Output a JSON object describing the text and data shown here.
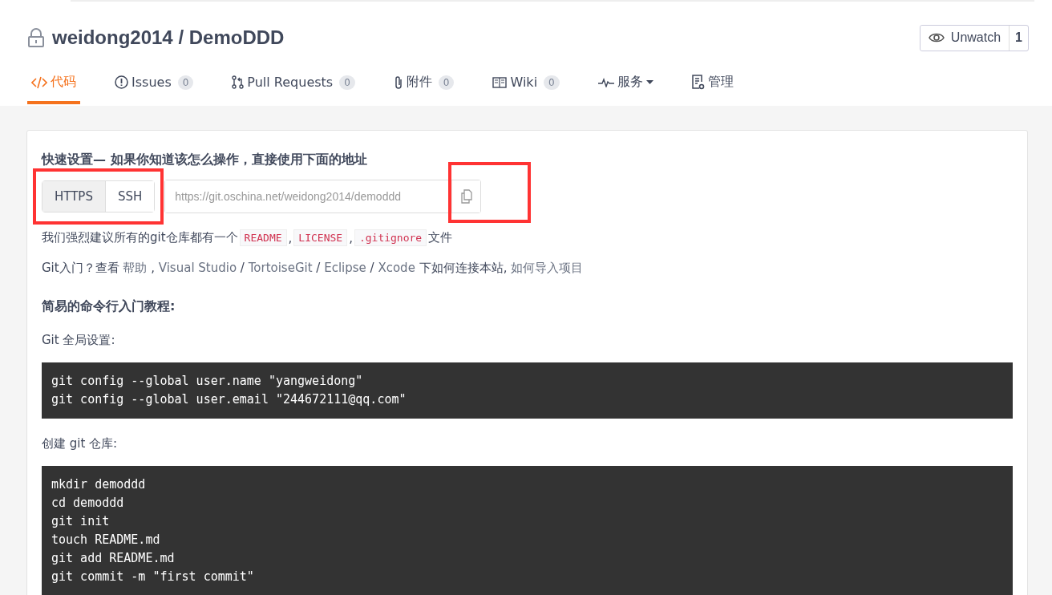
{
  "repo": {
    "owner": "weidong2014",
    "separator": "/",
    "name": "DemoDDD",
    "private": true
  },
  "watch": {
    "label": "Unwatch",
    "count": "1"
  },
  "tabs": [
    {
      "label": "代码",
      "dropdown": false,
      "selected": true
    },
    {
      "label": "Issues",
      "count": "0",
      "dropdown": false,
      "selected": false
    },
    {
      "label": "Pull Requests",
      "count": "0",
      "dropdown": false,
      "selected": false
    },
    {
      "label": "附件",
      "count": "0",
      "dropdown": false,
      "selected": false
    },
    {
      "label": "Wiki",
      "count": "0",
      "dropdown": false,
      "selected": false
    },
    {
      "label": "服务",
      "dropdown": true,
      "selected": false
    },
    {
      "label": "管理",
      "dropdown": false,
      "selected": false
    }
  ],
  "quick_setup": {
    "title": "快速设置— 如果你知道该怎么操作，直接使用下面的地址",
    "protocols": [
      {
        "label": "HTTPS",
        "selected": true
      },
      {
        "label": "SSH",
        "selected": false
      }
    ],
    "url": "https://git.oschina.net/weidong2014/demoddd",
    "highlights": {
      "protocols": true,
      "copy": true
    },
    "recommend": [
      {
        "kind": "text",
        "text": "我们强烈建议所有的git仓库都有一个"
      },
      {
        "kind": "code",
        "text": "README"
      },
      {
        "kind": "text",
        "text": ","
      },
      {
        "kind": "code",
        "text": "LICENSE"
      },
      {
        "kind": "text",
        "text": ","
      },
      {
        "kind": "code",
        "text": ".gitignore"
      },
      {
        "kind": "text",
        "text": "文件"
      }
    ],
    "help": [
      {
        "kind": "text",
        "text": "Git入门？查看 "
      },
      {
        "kind": "link",
        "text": "帮助"
      },
      {
        "kind": "text",
        "text": " , "
      },
      {
        "kind": "link",
        "text": "Visual Studio"
      },
      {
        "kind": "text",
        "text": " / "
      },
      {
        "kind": "link",
        "text": "TortoiseGit"
      },
      {
        "kind": "text",
        "text": " / "
      },
      {
        "kind": "link",
        "text": "Eclipse"
      },
      {
        "kind": "text",
        "text": " / "
      },
      {
        "kind": "link",
        "text": "Xcode"
      },
      {
        "kind": "text",
        "text": " 下如何连接本站, "
      },
      {
        "kind": "link",
        "text": "如何导入项目"
      }
    ]
  },
  "tutorial": {
    "title": "简易的命令行入门教程:",
    "sections": [
      {
        "label": "Git 全局设置:",
        "lines": [
          "git config --global user.name \"yangweidong\"",
          "git config --global user.email \"244672111@qq.com\""
        ]
      },
      {
        "label": "创建 git 仓库:",
        "lines": [
          "mkdir demoddd",
          "cd demoddd",
          "git init",
          "touch README.md",
          "git add README.md",
          "git commit -m \"first commit\""
        ]
      }
    ]
  }
}
